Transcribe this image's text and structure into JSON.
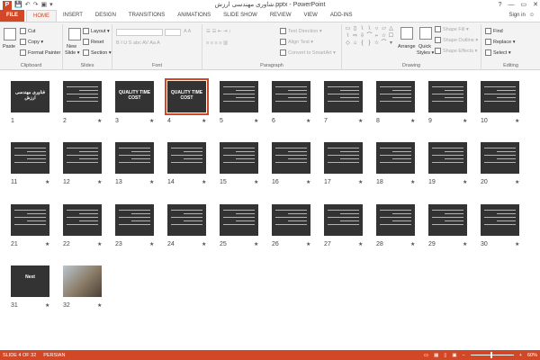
{
  "window": {
    "title": "شاوری مهندسی ارزش.pptx - PowerPoint",
    "help": "?",
    "minimize": "—",
    "restore": "▭",
    "close": "✕"
  },
  "qat": {
    "save": "💾",
    "undo": "↶",
    "redo": "↷",
    "start": "▣",
    "customize": "▾"
  },
  "tabs": [
    "FILE",
    "HOME",
    "INSERT",
    "DESIGN",
    "TRANSITIONS",
    "ANIMATIONS",
    "SLIDE SHOW",
    "REVIEW",
    "VIEW",
    "ADD-INS"
  ],
  "active_tab": "HOME",
  "account": {
    "signin": "Sign in",
    "smiley": "☺"
  },
  "ribbon": {
    "clipboard": {
      "label": "Clipboard",
      "paste": "Paste",
      "cut": "Cut",
      "copy": "Copy ▾",
      "format_painter": "Format Painter"
    },
    "slides": {
      "label": "Slides",
      "new_slide": "New",
      "new_slide_2": "Slide ▾",
      "layout": "Layout ▾",
      "reset": "Reset",
      "section": "Section ▾"
    },
    "font": {
      "label": "Font"
    },
    "paragraph": {
      "label": "Paragraph",
      "text_direction": "Text Direction ▾",
      "align_text": "Align Text ▾",
      "convert": "Convert to SmartArt ▾"
    },
    "drawing": {
      "label": "Drawing",
      "arrange": "Arrange",
      "quick_styles": "Quick",
      "quick_styles_2": "Styles ▾",
      "shape_fill": "Shape Fill ▾",
      "shape_outline": "Shape Outline ▾",
      "shape_effects": "Shape Effects ▾"
    },
    "editing": {
      "label": "Editing",
      "find": "Find",
      "replace": "Replace ▾",
      "select": "Select ▾"
    }
  },
  "slides": [
    {
      "n": "1",
      "star": "",
      "kind": "title",
      "text": "فناوری مهندسی ارزش"
    },
    {
      "n": "2",
      "star": "★",
      "kind": "text"
    },
    {
      "n": "3",
      "star": "★",
      "kind": "big",
      "text": "QUALITY TIME COST"
    },
    {
      "n": "4",
      "star": "★",
      "kind": "big",
      "text": "QUALITY TIME COST"
    },
    {
      "n": "5",
      "star": "★",
      "kind": "text"
    },
    {
      "n": "6",
      "star": "★",
      "kind": "text"
    },
    {
      "n": "7",
      "star": "★",
      "kind": "text"
    },
    {
      "n": "8",
      "star": "★",
      "kind": "text"
    },
    {
      "n": "9",
      "star": "★",
      "kind": "text"
    },
    {
      "n": "10",
      "star": "★",
      "kind": "text"
    },
    {
      "n": "11",
      "star": "★",
      "kind": "text"
    },
    {
      "n": "12",
      "star": "★",
      "kind": "text"
    },
    {
      "n": "13",
      "star": "★",
      "kind": "text"
    },
    {
      "n": "14",
      "star": "★",
      "kind": "text"
    },
    {
      "n": "15",
      "star": "★",
      "kind": "text"
    },
    {
      "n": "16",
      "star": "★",
      "kind": "text"
    },
    {
      "n": "17",
      "star": "★",
      "kind": "text"
    },
    {
      "n": "18",
      "star": "★",
      "kind": "text"
    },
    {
      "n": "19",
      "star": "★",
      "kind": "text"
    },
    {
      "n": "20",
      "star": "★",
      "kind": "text"
    },
    {
      "n": "21",
      "star": "★",
      "kind": "text"
    },
    {
      "n": "22",
      "star": "★",
      "kind": "text"
    },
    {
      "n": "23",
      "star": "★",
      "kind": "text"
    },
    {
      "n": "24",
      "star": "★",
      "kind": "text"
    },
    {
      "n": "25",
      "star": "★",
      "kind": "text"
    },
    {
      "n": "26",
      "star": "★",
      "kind": "text"
    },
    {
      "n": "27",
      "star": "★",
      "kind": "text"
    },
    {
      "n": "28",
      "star": "★",
      "kind": "text"
    },
    {
      "n": "29",
      "star": "★",
      "kind": "text"
    },
    {
      "n": "30",
      "star": "★",
      "kind": "text"
    },
    {
      "n": "31",
      "star": "★",
      "kind": "big",
      "text": "Next"
    },
    {
      "n": "32",
      "star": "★",
      "kind": "photo"
    }
  ],
  "selected_slide": "4",
  "status": {
    "slide_info": "SLIDE 4 OF 32",
    "language": "PERSIAN",
    "zoom": "60%",
    "zoom_level": 0.6
  },
  "colors": {
    "accent": "#d24726",
    "thumb_bg": "#333333"
  }
}
